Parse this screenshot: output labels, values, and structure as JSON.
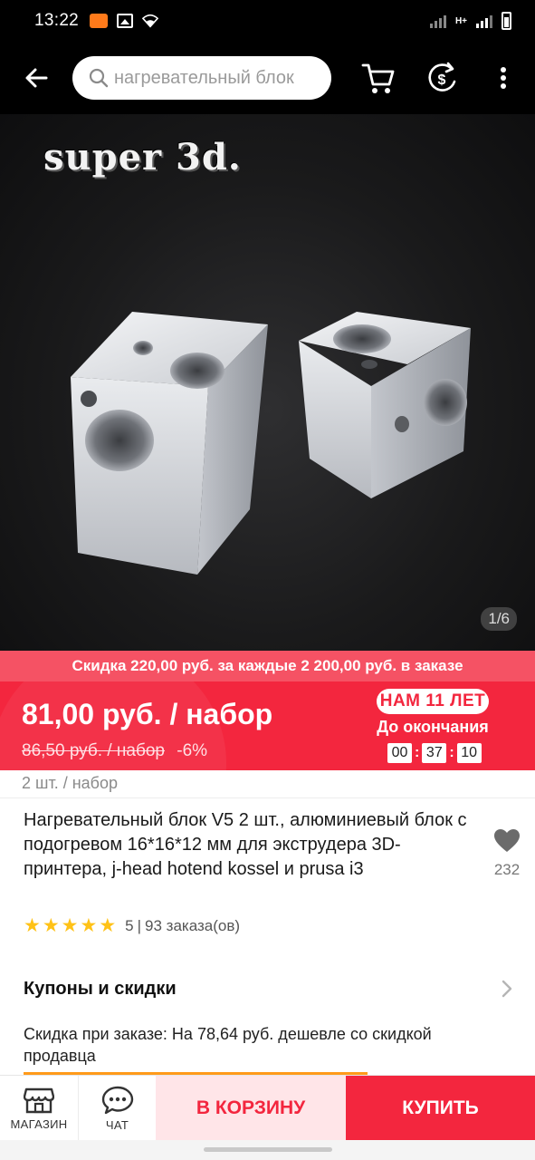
{
  "status_bar": {
    "time": "13:22",
    "network": "H+"
  },
  "header": {
    "search_placeholder": "нагревательный блок",
    "icons": [
      "back-arrow-icon",
      "search-icon",
      "cart-icon",
      "currency-icon",
      "more-icon"
    ]
  },
  "gallery": {
    "watermark": "super 3d.",
    "counter": "1/6"
  },
  "promo": {
    "text": "Скидка 220,00 руб. за каждые 2 200,00 руб. в заказе"
  },
  "price": {
    "current": "81,00 руб. / набор",
    "old": "86,50 руб. / набор",
    "discount": "-6%",
    "sale_badge": "НАМ 11 ЛЕТ",
    "sale_until": "До окончания",
    "countdown": {
      "hours": "00",
      "minutes": "37",
      "seconds": "10"
    }
  },
  "product": {
    "unit": "2 шт. / набор",
    "title": "Нагревательный блок V5 2 шт., алюминиевый блок с подогревом 16*16*12 мм для экструдера 3D-принтера, j-head hotend kossel и prusa i3",
    "wishlist_count": "232",
    "rating": "5",
    "orders": "93 заказа(ов)",
    "stars": 5
  },
  "coupons": {
    "title": "Купоны и скидки",
    "text": "Скидка при заказе: На 78,64 руб. дешевле со скидкой продавца"
  },
  "action_bar": {
    "store_label": "МАГАЗИН",
    "chat_label": "ЧАТ",
    "cart_label": "В КОРЗИНУ",
    "buy_label": "КУПИТЬ"
  },
  "colors": {
    "accent_red": "#f3263e",
    "promo_pink": "#f55264",
    "cart_bg": "#ffe5e8",
    "star_yellow": "#ffc217"
  }
}
